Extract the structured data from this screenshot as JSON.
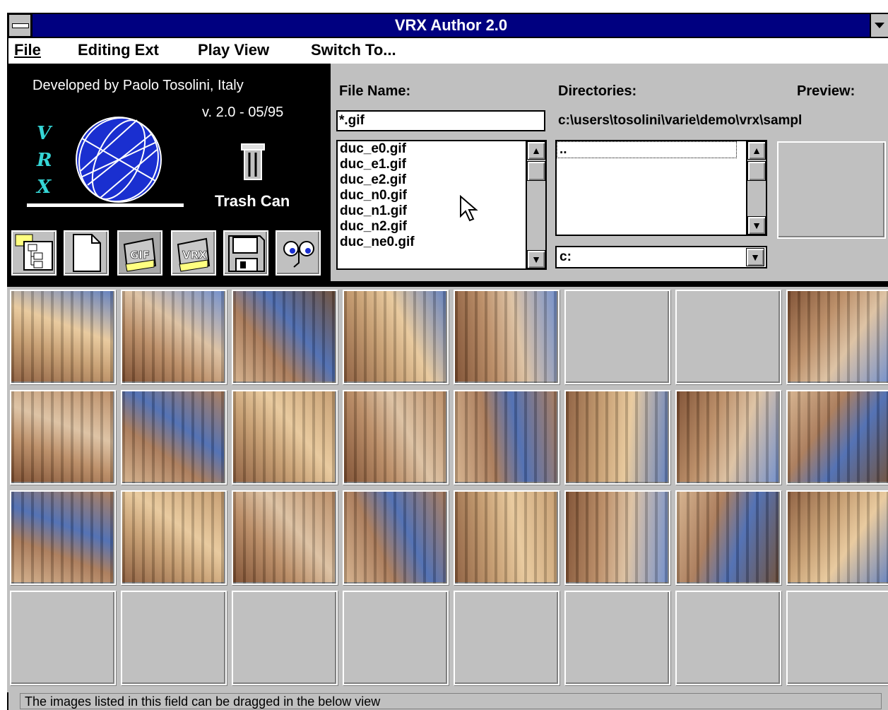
{
  "window": {
    "title": "VRX Author 2.0"
  },
  "menu": [
    {
      "label": "File",
      "mnemonic": "F"
    },
    {
      "label": "Editing Ext",
      "mnemonic": "E"
    },
    {
      "label": "Play View",
      "mnemonic": "P"
    },
    {
      "label": "Switch To...",
      "mnemonic": "S"
    }
  ],
  "logo": {
    "developer": "Developed by Paolo Tosolini, Italy",
    "version": "v. 2.0 - 05/95",
    "letters": [
      "V",
      "R",
      "X"
    ],
    "trash_label": "Trash Can"
  },
  "toolbar": [
    {
      "name": "tree-tool-button",
      "icon": "tree-icon"
    },
    {
      "name": "new-document-button",
      "icon": "document-icon"
    },
    {
      "name": "gif-folder-button",
      "icon": "gif-folder-icon",
      "label": "GIF"
    },
    {
      "name": "vrx-folder-button",
      "icon": "vrx-folder-icon",
      "label": "VRX"
    },
    {
      "name": "save-button",
      "icon": "floppy-disk-icon"
    },
    {
      "name": "view-button",
      "icon": "eyes-icon"
    }
  ],
  "file_panel": {
    "file_name_label": "File Name:",
    "file_name_value": "*.gif",
    "files": [
      "duc_e0.gif",
      "duc_e1.gif",
      "duc_e2.gif",
      "duc_n0.gif",
      "duc_n1.gif",
      "duc_n2.gif",
      "duc_ne0.gif"
    ],
    "directories_label": "Directories:",
    "directory_path": "c:\\users\\tosolini\\varie\\demo\\vrx\\sampl",
    "directories": "..",
    "drive": "c:",
    "preview_label": "Preview:"
  },
  "grid": {
    "rows": 4,
    "cols": 8,
    "filled": [
      [
        true,
        true,
        true,
        true,
        true,
        false,
        false,
        true
      ],
      [
        true,
        true,
        true,
        true,
        true,
        true,
        true,
        true
      ],
      [
        true,
        true,
        true,
        true,
        true,
        true,
        true,
        true
      ],
      [
        false,
        false,
        false,
        false,
        false,
        false,
        false,
        false
      ]
    ]
  },
  "status": {
    "text": "The images listed in this field can be dragged in the below view"
  },
  "colors": {
    "titlebar": "#000080",
    "panel": "#c0c0c0",
    "logo_bg": "#000000",
    "vrx_letters": "#35d6d6",
    "globe": "#1a2fd0"
  }
}
